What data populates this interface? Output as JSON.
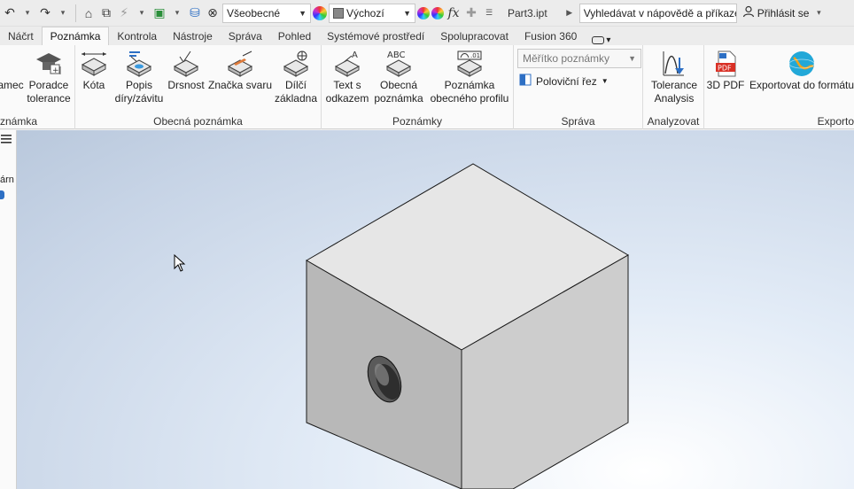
{
  "qat": {
    "appearance_style": "Všeobecné",
    "visual_style": "Výchozí",
    "fx_label": "fx",
    "document_name": "Part3.ipt",
    "search_placeholder": "Vyhledávat v nápovědě a příkaze",
    "signin_label": "Přihlásit se"
  },
  "tabs": [
    {
      "label": "Náčrt",
      "active": false
    },
    {
      "label": "Poznámka",
      "active": true
    },
    {
      "label": "Kontrola",
      "active": false
    },
    {
      "label": "Nástroje",
      "active": false
    },
    {
      "label": "Správa",
      "active": false
    },
    {
      "label": "Pohled",
      "active": false
    },
    {
      "label": "Systémové prostředí",
      "active": false
    },
    {
      "label": "Spolupracovat",
      "active": false
    },
    {
      "label": "Fusion 360",
      "active": false
    }
  ],
  "ribbon": {
    "panels": {
      "p0": {
        "title": "známka",
        "buttons": [
          {
            "label1": "amec",
            "label2": ""
          },
          {
            "label1": "Poradce",
            "label2": "tolerance"
          }
        ]
      },
      "p1": {
        "title": "Obecná poznámka",
        "buttons": [
          {
            "label1": "Kóta",
            "label2": ""
          },
          {
            "label1": "Popis",
            "label2": "díry/závitu"
          },
          {
            "label1": "Drsnost",
            "label2": ""
          },
          {
            "label1": "Značka svaru",
            "label2": ""
          },
          {
            "label1": "Dílčí",
            "label2": "základna"
          }
        ]
      },
      "p2": {
        "title": "Poznámky",
        "buttons": [
          {
            "label1": "Text s",
            "label2": "odkazem"
          },
          {
            "label1": "Obecná",
            "label2": "poznámka"
          },
          {
            "label1": "Poznámka",
            "label2": "obecného profilu"
          }
        ]
      },
      "p3": {
        "title": "Správa",
        "scale_placeholder": "Měřítko poznámky",
        "half_section": "Poloviční řez"
      },
      "p4": {
        "title": "Analyzovat",
        "buttons": [
          {
            "label1": "Tolerance",
            "label2": "Analysis"
          }
        ]
      },
      "p5": {
        "title": "Exporto",
        "buttons": [
          {
            "label1": "3D PDF",
            "label2": ""
          },
          {
            "label1": "Exportovat do formátu",
            "label2": ""
          }
        ]
      }
    }
  },
  "browser": {
    "truncated_label": "árn"
  },
  "colors": {
    "accent_tab": "#fafafa",
    "viewport_top": "#c7d4e6",
    "viewport_glow": "#ffffff",
    "cube_top": "#e6e6e6",
    "cube_left": "#b3b3b3",
    "cube_right": "#cccccc"
  }
}
